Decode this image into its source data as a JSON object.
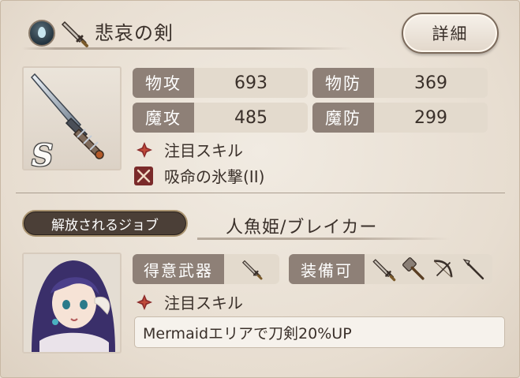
{
  "weapon": {
    "name": "悲哀の剣",
    "element_icon": "water-element-icon",
    "type_icon": "sword-icon",
    "rank": "S"
  },
  "detail_button": {
    "label": "詳細"
  },
  "stats": [
    {
      "label": "物攻",
      "value": "693"
    },
    {
      "label": "物防",
      "value": "369"
    },
    {
      "label": "魔攻",
      "value": "485"
    },
    {
      "label": "魔防",
      "value": "299"
    }
  ],
  "skills": [
    {
      "icon": "cross-star-icon",
      "label": "注目スキル"
    },
    {
      "icon": "crossed-swords-icon",
      "label": "吸命の氷撃(II)"
    }
  ],
  "job": {
    "tag_label": "解放されるジョブ",
    "name": "人魚姫/ブレイカー",
    "weapon_label": "得意武器",
    "equip_label": "装備可",
    "focus_skill_label": "注目スキル",
    "passive": "Mermaidエリアで刀剣20%UP",
    "weapon_icons": [
      "sword-icon"
    ],
    "equip_icons": [
      "sword-icon",
      "hammer-icon",
      "bow-icon",
      "spear-icon"
    ]
  },
  "colors": {
    "label_bg": "#8e8077",
    "value_bg": "#e3dacd",
    "skill_icon_bg": "#7a2a2a",
    "job_tag_bg": "#4b3f37"
  }
}
